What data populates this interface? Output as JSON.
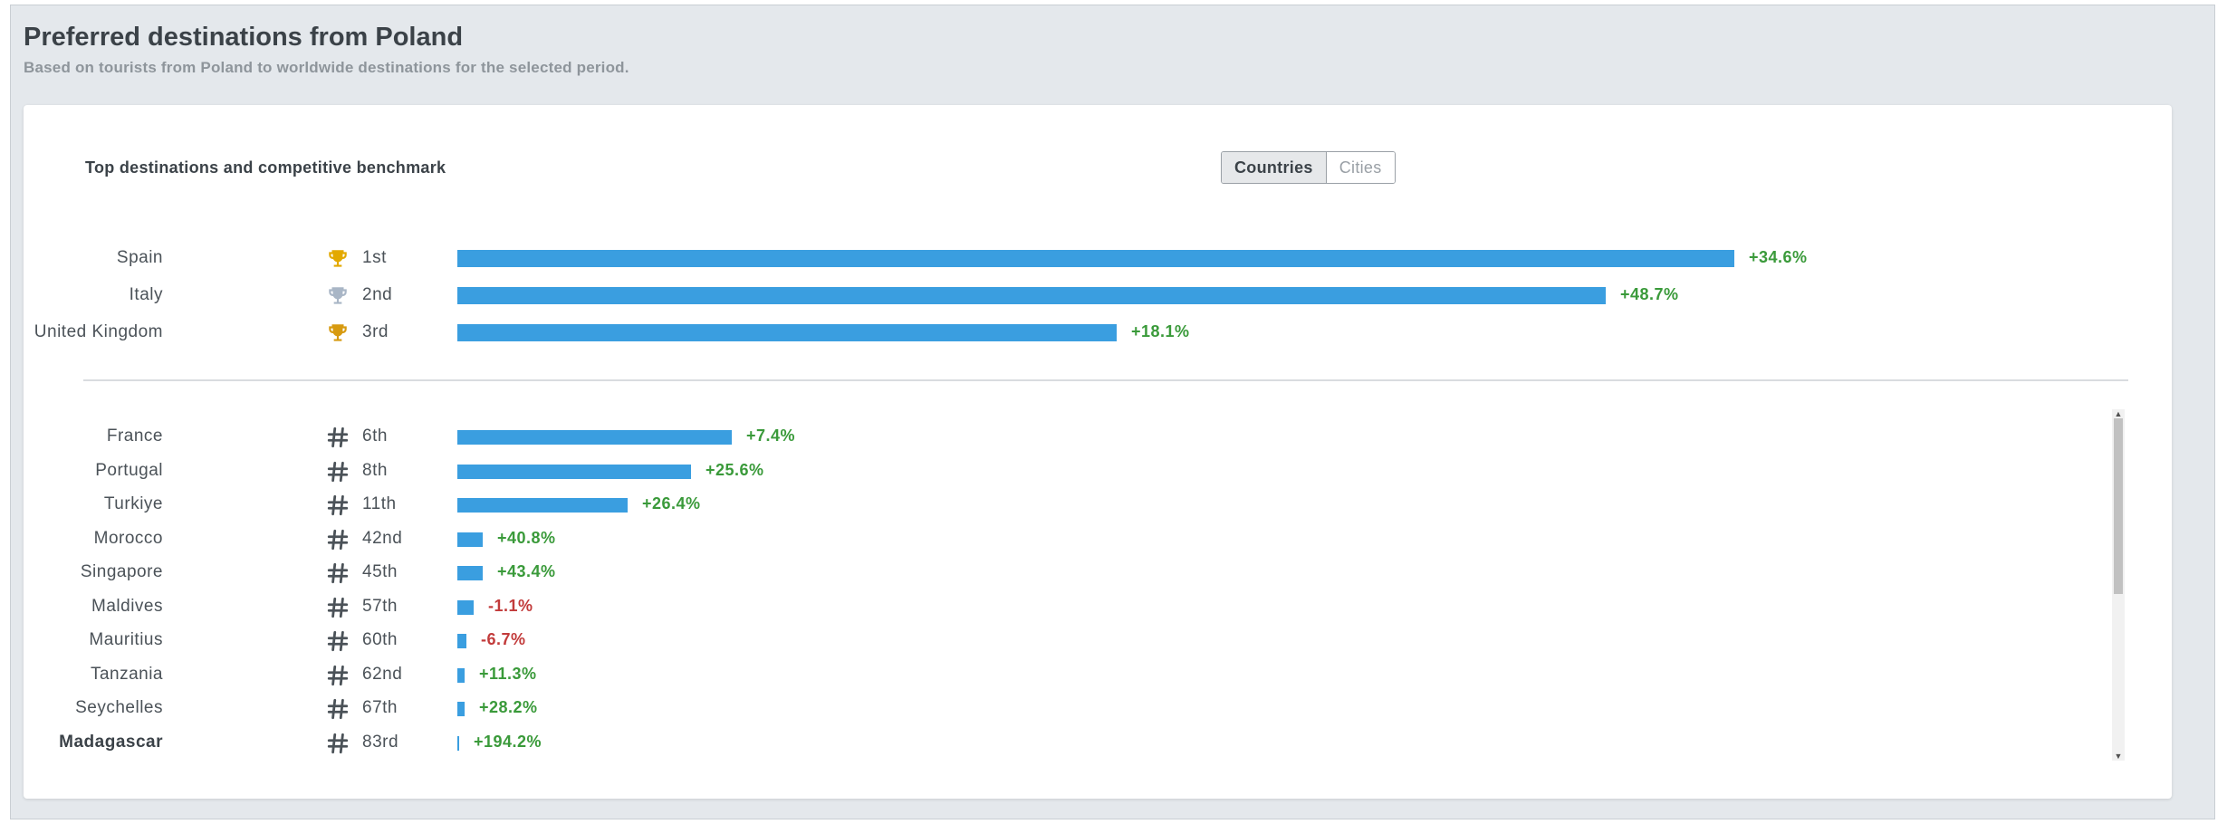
{
  "header": {
    "title": "Preferred destinations from Poland",
    "subtitle": "Based on tourists from Poland to worldwide destinations for the selected period."
  },
  "card": {
    "title": "Top destinations and competitive benchmark",
    "toggle": {
      "countries_label": "Countries",
      "cities_label": "Cities",
      "selected": "Countries"
    }
  },
  "colors": {
    "bar": "#3a9ee0",
    "positive": "#3a9a3a",
    "negative": "#c23b3b",
    "gold": "#e3a900",
    "silver": "#a9b6c6",
    "bronze": "#d79a10",
    "hash": "#4b5258"
  },
  "top_destinations": [
    {
      "name": "Spain",
      "rank": "1st",
      "icon": "gold-trophy-icon",
      "bar_value": 1.0,
      "change": "+34.6%",
      "trend": "positive"
    },
    {
      "name": "Italy",
      "rank": "2nd",
      "icon": "silver-trophy-icon",
      "bar_value": 0.899,
      "change": "+48.7%",
      "trend": "positive"
    },
    {
      "name": "United Kingdom",
      "rank": "3rd",
      "icon": "bronze-trophy-icon",
      "bar_value": 0.516,
      "change": "+18.1%",
      "trend": "positive"
    }
  ],
  "other_destinations": [
    {
      "name": "France",
      "rank": "6th",
      "icon": "hash-icon",
      "bar_value": 0.215,
      "change": "+7.4%",
      "trend": "positive"
    },
    {
      "name": "Portugal",
      "rank": "8th",
      "icon": "hash-icon",
      "bar_value": 0.183,
      "change": "+25.6%",
      "trend": "positive"
    },
    {
      "name": "Turkiye",
      "rank": "11th",
      "icon": "hash-icon",
      "bar_value": 0.133,
      "change": "+26.4%",
      "trend": "positive"
    },
    {
      "name": "Morocco",
      "rank": "42nd",
      "icon": "hash-icon",
      "bar_value": 0.02,
      "change": "+40.8%",
      "trend": "positive"
    },
    {
      "name": "Singapore",
      "rank": "45th",
      "icon": "hash-icon",
      "bar_value": 0.02,
      "change": "+43.4%",
      "trend": "positive"
    },
    {
      "name": "Maldives",
      "rank": "57th",
      "icon": "hash-icon",
      "bar_value": 0.013,
      "change": "-1.1%",
      "trend": "negative"
    },
    {
      "name": "Mauritius",
      "rank": "60th",
      "icon": "hash-icon",
      "bar_value": 0.007,
      "change": "-6.7%",
      "trend": "negative"
    },
    {
      "name": "Tanzania",
      "rank": "62nd",
      "icon": "hash-icon",
      "bar_value": 0.006,
      "change": "+11.3%",
      "trend": "positive"
    },
    {
      "name": "Seychelles",
      "rank": "67th",
      "icon": "hash-icon",
      "bar_value": 0.006,
      "change": "+28.2%",
      "trend": "positive"
    },
    {
      "name": "Madagascar",
      "rank": "83rd",
      "icon": "hash-icon",
      "bar_value": 0.001,
      "change": "+194.2%",
      "trend": "positive",
      "highlight": true
    }
  ]
}
